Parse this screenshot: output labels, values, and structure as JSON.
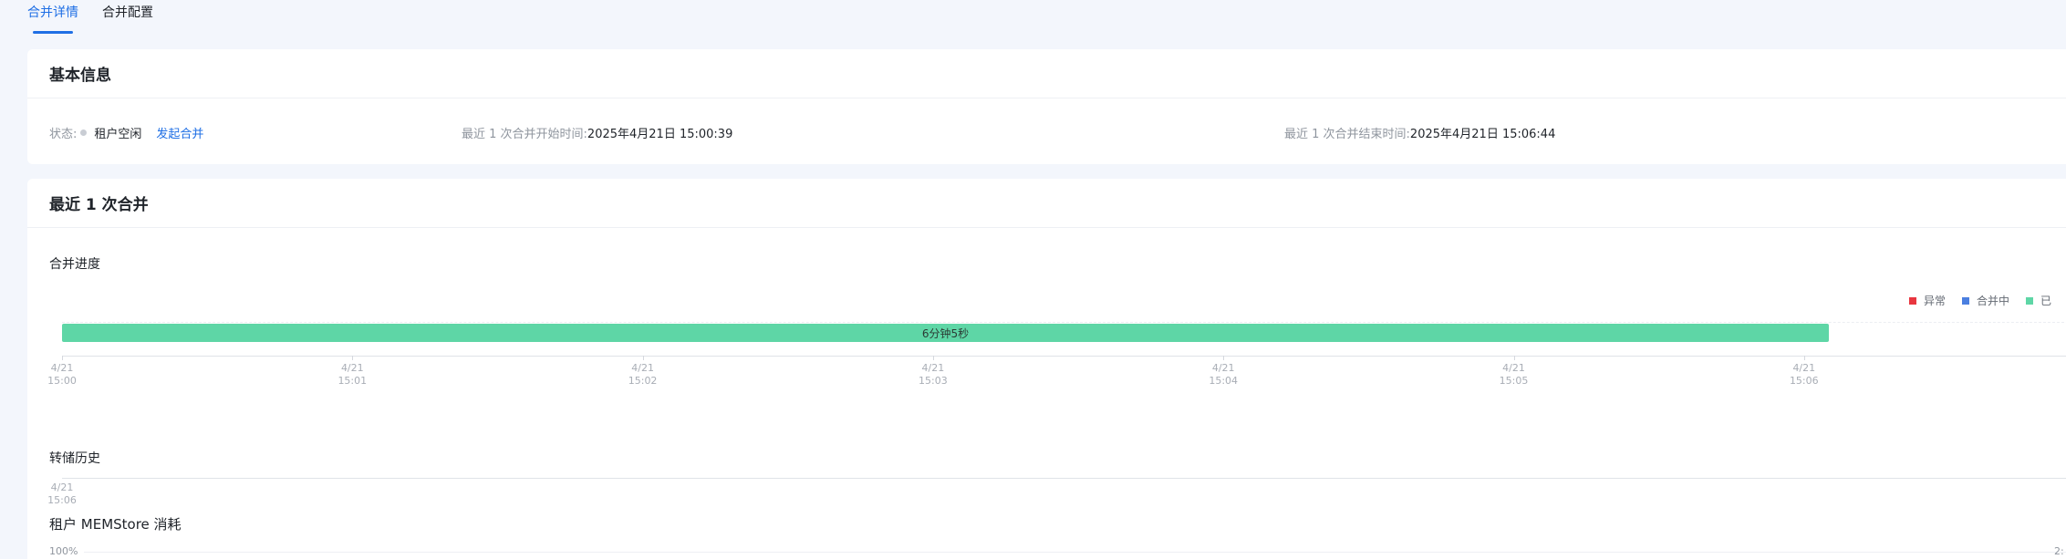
{
  "tabs": [
    {
      "label": "合并详情",
      "active": true
    },
    {
      "label": "合并配置",
      "active": false
    }
  ],
  "basic": {
    "title": "基本信息",
    "status_label": "状态:",
    "status_value": "租户空闲",
    "action_label": "发起合并",
    "start_label": "最近 1 次合并开始时间:",
    "start_value": "2025年4月21日 15:00:39",
    "end_label": "最近 1 次合并结束时间:",
    "end_value": "2025年4月21日 15:06:44"
  },
  "recent": {
    "title": "最近 1 次合并",
    "progress_label": "合并进度",
    "legend": [
      {
        "label": "异常",
        "color": "#e8363f"
      },
      {
        "label": "合并中",
        "color": "#4b7fe0"
      },
      {
        "label": "已",
        "color": "#5ed6a6"
      }
    ],
    "bar_label": "6分钟5秒",
    "bar_color": "#5ed6a6",
    "progress_fraction": 0.905,
    "progress_ticks": [
      {
        "date": "4/21",
        "time": "15:00"
      },
      {
        "date": "4/21",
        "time": "15:01"
      },
      {
        "date": "4/21",
        "time": "15:02"
      },
      {
        "date": "4/21",
        "time": "15:03"
      },
      {
        "date": "4/21",
        "time": "15:04"
      },
      {
        "date": "4/21",
        "time": "15:05"
      },
      {
        "date": "4/21",
        "time": "15:06"
      }
    ],
    "history_label": "转储历史",
    "history_tick": {
      "date": "4/21",
      "time": "15:06"
    },
    "memstore_label": "租户 MEMStore 消耗",
    "memstore_y_top": "100%",
    "memstore_right_value": "2:"
  }
}
